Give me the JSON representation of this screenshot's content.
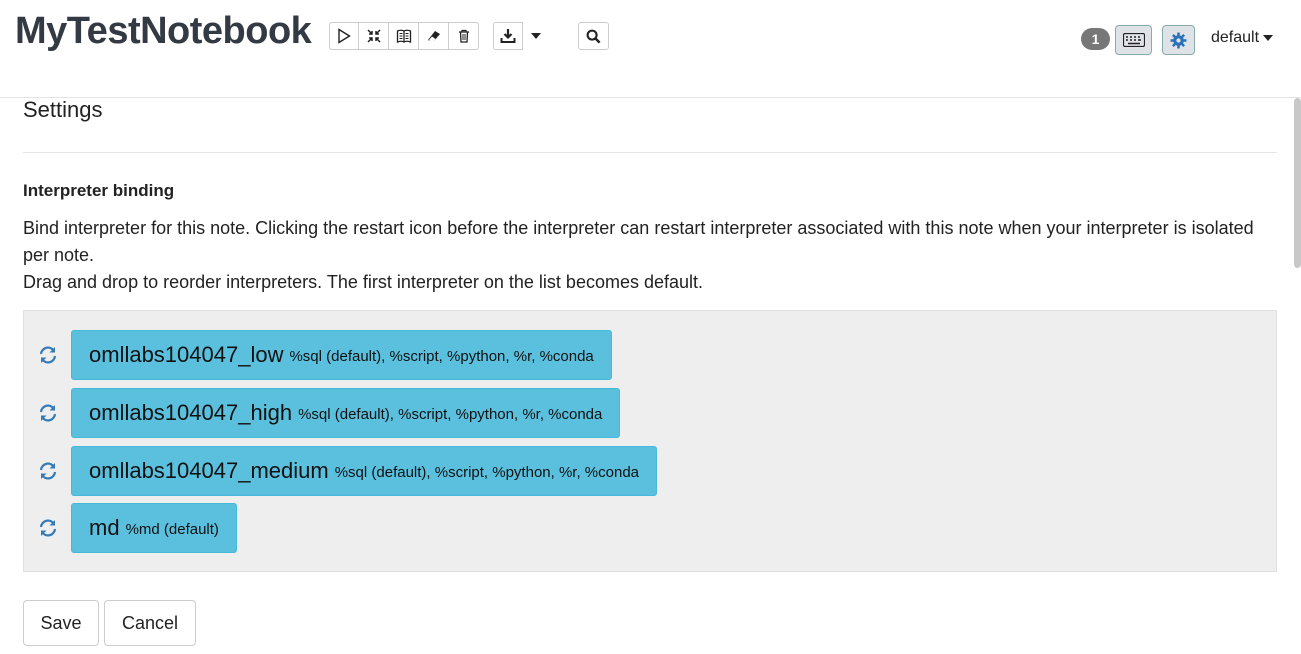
{
  "header": {
    "title": "MyTestNotebook",
    "toolbar_icons": [
      "run-all-icon",
      "collapse-icon",
      "book-icon",
      "eraser-icon",
      "trash-icon"
    ],
    "download_icon": "download-icon",
    "search_icon": "search-icon",
    "badge_count": "1",
    "keyboard_icon": "keyboard-icon",
    "settings_icon": "gear-icon",
    "user_menu_label": "default"
  },
  "settings": {
    "title": "Settings",
    "section_heading": "Interpreter binding",
    "desc_line1": "Bind interpreter for this note. Clicking the restart icon before the interpreter can restart interpreter associated with this note when your interpreter is isolated per note.",
    "desc_line2": "Drag and drop to reorder interpreters. The first interpreter on the list becomes default.",
    "interpreters": [
      {
        "name": "omllabs104047_low",
        "langs": "%sql (default), %script, %python, %r, %conda"
      },
      {
        "name": "omllabs104047_high",
        "langs": "%sql (default), %script, %python, %r, %conda"
      },
      {
        "name": "omllabs104047_medium",
        "langs": "%sql (default), %script, %python, %r, %conda"
      },
      {
        "name": "md",
        "langs": "%md (default)"
      }
    ],
    "save_label": "Save",
    "cancel_label": "Cancel"
  },
  "colors": {
    "interpreter_pill": "#5bc0de",
    "restart_icon": "#337ab7",
    "panel_bg": "#eeeeee"
  }
}
